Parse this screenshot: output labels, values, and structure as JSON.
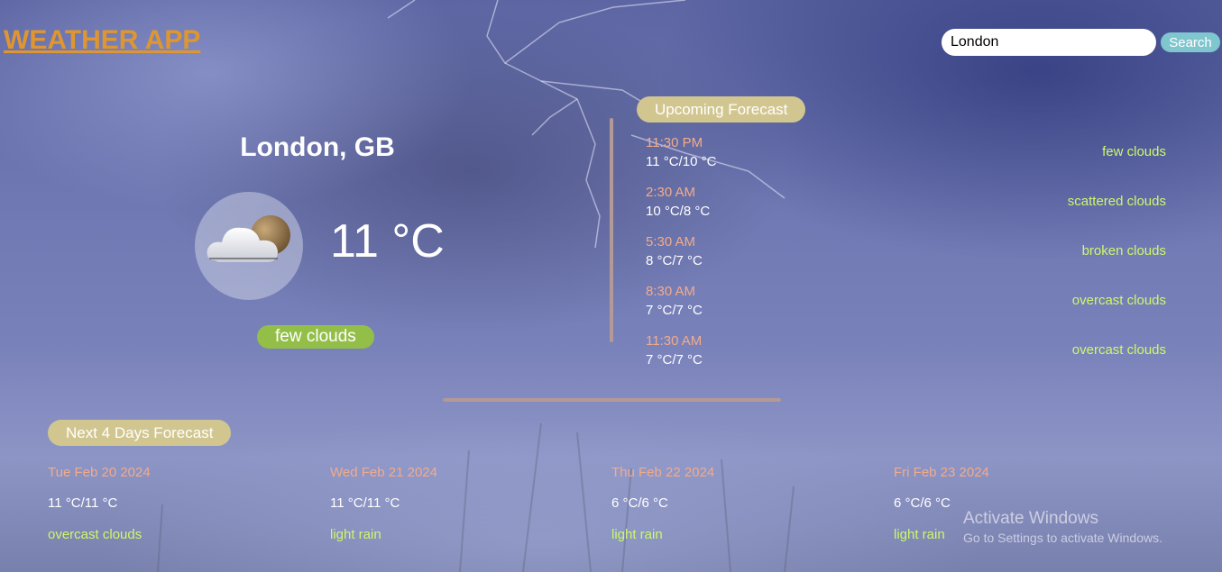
{
  "app_title": "WEATHER APP",
  "search": {
    "value": "London",
    "button_label": "Search"
  },
  "current": {
    "city": "London, GB",
    "temperature": "11 °C",
    "condition": "few clouds",
    "icon": "few-clouds-icon"
  },
  "upcoming": {
    "heading": "Upcoming Forecast",
    "items": [
      {
        "time": "11:30 PM",
        "temp": "11 °C/10 °C",
        "desc": "few clouds"
      },
      {
        "time": "2:30 AM",
        "temp": "10 °C/8 °C",
        "desc": "scattered clouds"
      },
      {
        "time": "5:30 AM",
        "temp": "8 °C/7 °C",
        "desc": "broken clouds"
      },
      {
        "time": "8:30 AM",
        "temp": "7 °C/7 °C",
        "desc": "overcast clouds"
      },
      {
        "time": "11:30 AM",
        "temp": "7 °C/7 °C",
        "desc": "overcast clouds"
      }
    ]
  },
  "next_days": {
    "heading": "Next 4 Days Forecast",
    "days": [
      {
        "date": "Tue Feb 20 2024",
        "temp": "11 °C/11 °C",
        "desc": "overcast clouds"
      },
      {
        "date": "Wed Feb 21 2024",
        "temp": "11 °C/11 °C",
        "desc": "light rain"
      },
      {
        "date": "Thu Feb 22 2024",
        "temp": "6 °C/6 °C",
        "desc": "light rain"
      },
      {
        "date": "Fri Feb 23 2024",
        "temp": "6 °C/6 °C",
        "desc": "light rain"
      }
    ]
  },
  "watermark": {
    "title": "Activate Windows",
    "subtitle": "Go to Settings to activate Windows."
  },
  "colors": {
    "title": "#e0962f",
    "time_text": "#f2ab8b",
    "description_text": "#cdf86a",
    "section_pill": "#d2c690",
    "condition_pill": "#93bf48",
    "search_button": "#7fc6cf",
    "divider": "#b49a96"
  }
}
